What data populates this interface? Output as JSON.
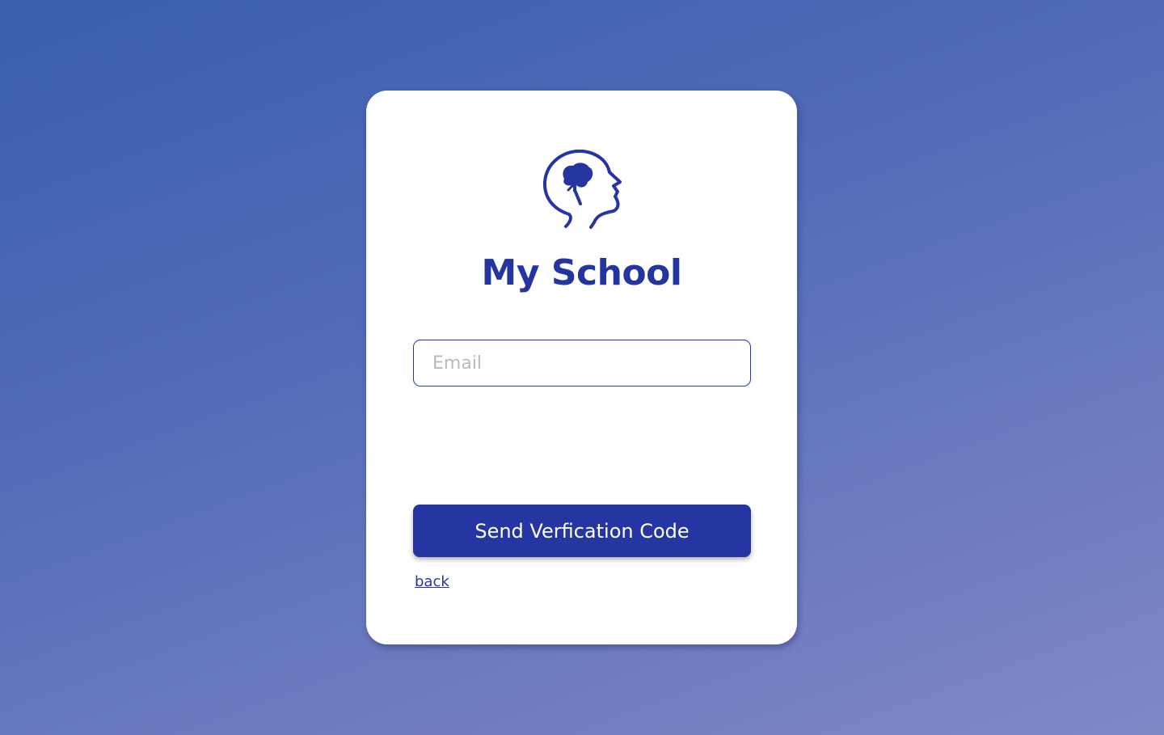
{
  "app": {
    "title": "My School"
  },
  "logo": {
    "icon": "head-brain-icon"
  },
  "form": {
    "email_placeholder": "Email",
    "email_value": "",
    "submit_label": "Send Verfication Code",
    "back_label": "back"
  },
  "colors": {
    "accent": "#2536a2",
    "background_start": "#3a5fae",
    "background_end": "#8288c6",
    "card": "#ffffff",
    "placeholder": "#b9b9c2"
  }
}
